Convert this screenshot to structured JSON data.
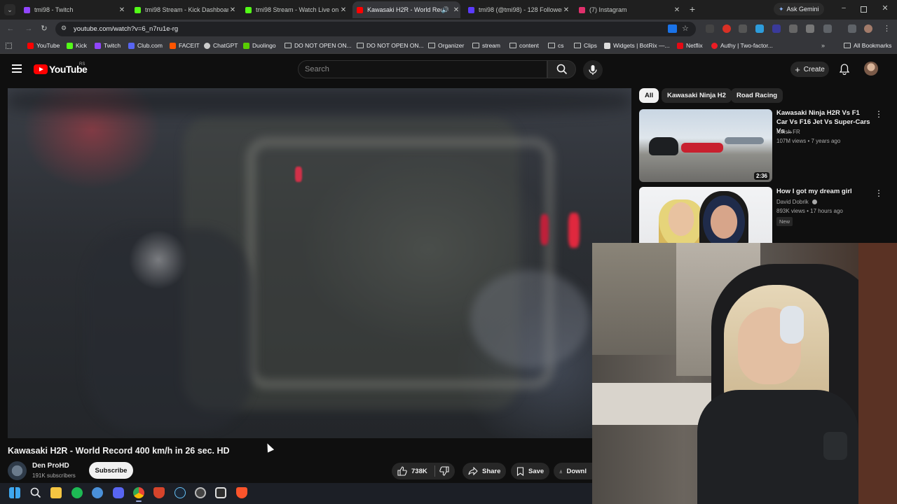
{
  "browser": {
    "tabs": [
      {
        "title": "tmi98 - Twitch",
        "icon": "twitch-icon",
        "color": "#9146ff",
        "active": false
      },
      {
        "title": "tmi98 Stream - Kick Dashboard",
        "icon": "kick-icon",
        "color": "#53fc18",
        "active": false
      },
      {
        "title": "tmi98 Stream - Watch Live on Kick",
        "icon": "kick-icon",
        "color": "#53fc18",
        "active": false
      },
      {
        "title": "Kawasaki H2R - World Record 400 km/h in 26 sec. HD",
        "icon": "youtube-icon",
        "color": "#ff0000",
        "active": true
      },
      {
        "title": "tmi98 (@tmi98) - 128 Followers",
        "icon": "twitch-icon",
        "color": "#5b3bff",
        "active": false
      },
      {
        "title": "(7) Instagram",
        "icon": "instagram-icon",
        "color": "#e1306c",
        "active": false
      }
    ],
    "new_tab_symbol": "+",
    "ask_gemini": "Ask Gemini",
    "url": "youtube.com/watch?v=6_n7ru1e-rg",
    "bookmarks": [
      {
        "label": "YouTube",
        "kind": "site",
        "color": "#ff0000"
      },
      {
        "label": "Kick",
        "kind": "site",
        "color": "#53fc18"
      },
      {
        "label": "Twitch",
        "kind": "site",
        "color": "#9146ff"
      },
      {
        "label": "Club.com",
        "kind": "site",
        "color": "#5865f2"
      },
      {
        "label": "FACEIT",
        "kind": "site",
        "color": "#ff5500"
      },
      {
        "label": "ChatGPT",
        "kind": "site",
        "color": "#cccccc"
      },
      {
        "label": "Duolingo",
        "kind": "site",
        "color": "#58cc02"
      },
      {
        "label": "DO NOT OPEN ON...",
        "kind": "folder"
      },
      {
        "label": "DO NOT OPEN ON...",
        "kind": "folder"
      },
      {
        "label": "Organizer",
        "kind": "folder"
      },
      {
        "label": "stream",
        "kind": "folder"
      },
      {
        "label": "content",
        "kind": "folder"
      },
      {
        "label": "cs",
        "kind": "folder"
      },
      {
        "label": "Clips",
        "kind": "folder"
      },
      {
        "label": "Widgets | BotRix —...",
        "kind": "site",
        "color": "#dddddd"
      },
      {
        "label": "Netflix",
        "kind": "site",
        "color": "#e50914"
      },
      {
        "label": "Authy | Two-factor...",
        "kind": "site",
        "color": "#ec1c24"
      }
    ],
    "all_bookmarks": "All Bookmarks"
  },
  "youtube": {
    "logo_text": "YouTube",
    "country_code": "RS",
    "search_placeholder": "Search",
    "create_label": "Create",
    "chips": [
      "All",
      "Kawasaki Ninja H2",
      "Road Racing"
    ],
    "recommendations": [
      {
        "title": "Kawasaki Ninja H2R Vs F1 Car Vs F16 Jet Vs Super-Cars Vs ...",
        "channel": "Krrish FR",
        "meta": "107M views • 7 years ago",
        "duration": "2:36"
      },
      {
        "title": "How I got my dream girl",
        "channel": "David Dobrik",
        "meta": "893K views • 17 hours ago",
        "badge": "New"
      }
    ]
  },
  "video": {
    "title": "Kawasaki H2R - World Record 400 km/h in 26 sec. HD",
    "channel_name": "Den ProHD",
    "subscribers": "191K subscribers",
    "subscribe_label": "Subscribe",
    "likes": "738K",
    "share_label": "Share",
    "save_label": "Save",
    "download_label": "Downl"
  },
  "taskbar": {
    "apps": [
      "windows-start-icon",
      "search-icon",
      "file-explorer-icon",
      "spotify-icon",
      "app-icon",
      "discord-icon",
      "chrome-icon",
      "shield-app-icon",
      "steam-icon",
      "app-icon",
      "app-icon",
      "brave-icon"
    ]
  }
}
